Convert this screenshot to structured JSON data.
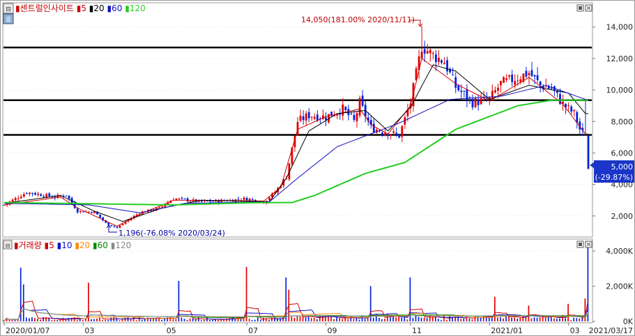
{
  "chart_data": [
    {
      "type": "candlestick",
      "title": "센트럴인사이트",
      "legend": [
        {
          "label": "5",
          "color": "#d00000"
        },
        {
          "label": "20",
          "color": "#000000"
        },
        {
          "label": "60",
          "color": "#1010c0"
        },
        {
          "label": "120",
          "color": "#22cc22"
        }
      ],
      "y_ticks": [
        "14,000",
        "12,000",
        "10,000",
        "8,000",
        "6,000",
        "4,000",
        "2,000"
      ],
      "y_tick_values": [
        14000,
        12000,
        10000,
        8000,
        6000,
        4000,
        2000
      ],
      "ylim": [
        750,
        15450
      ],
      "high_annotation": "14,050(181.00% 2020/11/11)",
      "low_annotation": "1,196(-76.08% 2020/03/24)",
      "current_price": "5,000",
      "current_change": "(-29.87%)",
      "horizontal_lines": [
        12700,
        9350,
        7150
      ],
      "price_anchors": [
        [
          0,
          2700
        ],
        [
          8,
          3500
        ],
        [
          18,
          3200
        ],
        [
          22,
          3350
        ],
        [
          26,
          2300
        ],
        [
          32,
          2250
        ],
        [
          36,
          1550
        ],
        [
          40,
          1250
        ],
        [
          44,
          1750
        ],
        [
          48,
          2200
        ],
        [
          55,
          2500
        ],
        [
          60,
          3100
        ],
        [
          70,
          2900
        ],
        [
          80,
          3000
        ],
        [
          86,
          3100
        ],
        [
          92,
          2900
        ],
        [
          96,
          3500
        ],
        [
          100,
          4500
        ],
        [
          104,
          8000
        ],
        [
          108,
          8400
        ],
        [
          114,
          8300
        ],
        [
          120,
          8800
        ],
        [
          124,
          8000
        ],
        [
          126,
          9200
        ],
        [
          130,
          7600
        ],
        [
          134,
          7400
        ],
        [
          140,
          7100
        ],
        [
          144,
          9200
        ],
        [
          148,
          12800
        ],
        [
          152,
          12200
        ],
        [
          156,
          11800
        ],
        [
          160,
          10200
        ],
        [
          166,
          9200
        ],
        [
          172,
          9400
        ],
        [
          176,
          10400
        ],
        [
          182,
          10800
        ],
        [
          186,
          11100
        ],
        [
          190,
          10300
        ],
        [
          194,
          10100
        ],
        [
          198,
          9100
        ],
        [
          202,
          8500
        ],
        [
          204,
          7500
        ],
        [
          206,
          7000
        ],
        [
          207,
          5000
        ]
      ],
      "ma_lines": {
        "ma5": [
          [
            0,
            2700
          ],
          [
            20,
            3200
          ],
          [
            26,
            2500
          ],
          [
            40,
            1350
          ],
          [
            48,
            2100
          ],
          [
            60,
            3000
          ],
          [
            92,
            2950
          ],
          [
            98,
            3800
          ],
          [
            104,
            7500
          ],
          [
            114,
            8300
          ],
          [
            126,
            8800
          ],
          [
            130,
            7800
          ],
          [
            136,
            7200
          ],
          [
            144,
            9000
          ],
          [
            148,
            12000
          ],
          [
            160,
            10400
          ],
          [
            172,
            9300
          ],
          [
            186,
            10800
          ],
          [
            198,
            9100
          ],
          [
            206,
            7200
          ]
        ],
        "ma20": [
          [
            0,
            2800
          ],
          [
            20,
            3300
          ],
          [
            32,
            2300
          ],
          [
            42,
            1650
          ],
          [
            56,
            2500
          ],
          [
            70,
            3000
          ],
          [
            94,
            2900
          ],
          [
            100,
            4400
          ],
          [
            108,
            7400
          ],
          [
            118,
            8500
          ],
          [
            128,
            8700
          ],
          [
            136,
            7400
          ],
          [
            144,
            8900
          ],
          [
            152,
            11600
          ],
          [
            160,
            11200
          ],
          [
            172,
            9400
          ],
          [
            186,
            10300
          ],
          [
            200,
            9800
          ],
          [
            206,
            8500
          ]
        ],
        "ma60": [
          [
            0,
            2800
          ],
          [
            30,
            2700
          ],
          [
            48,
            2200
          ],
          [
            64,
            2800
          ],
          [
            94,
            2900
          ],
          [
            104,
            4400
          ],
          [
            118,
            6400
          ],
          [
            140,
            7900
          ],
          [
            158,
            9400
          ],
          [
            176,
            9600
          ],
          [
            192,
            10300
          ],
          [
            206,
            9400
          ]
        ],
        "ma120": [
          [
            0,
            2850
          ],
          [
            40,
            2750
          ],
          [
            60,
            2700
          ],
          [
            90,
            2850
          ],
          [
            102,
            2850
          ],
          [
            110,
            3300
          ],
          [
            128,
            4700
          ],
          [
            142,
            5400
          ],
          [
            160,
            7500
          ],
          [
            182,
            9000
          ],
          [
            194,
            9350
          ],
          [
            206,
            9350
          ]
        ]
      }
    },
    {
      "type": "bar",
      "title": "거래량",
      "legend": [
        {
          "label": "5",
          "color": "#d00000"
        },
        {
          "label": "10",
          "color": "#1010c0"
        },
        {
          "label": "20",
          "color": "#ff8800"
        },
        {
          "label": "60",
          "color": "#008800"
        },
        {
          "label": "120",
          "color": "#888888"
        }
      ],
      "y_ticks": [
        "4,000K",
        "2,000K",
        "0K"
      ],
      "y_tick_values": [
        4000,
        2000,
        0
      ],
      "ylim": [
        0,
        4600
      ],
      "spikes": [
        [
          6,
          3050
        ],
        [
          7,
          2100
        ],
        [
          30,
          2200
        ],
        [
          62,
          2300
        ],
        [
          86,
          3100
        ],
        [
          100,
          2500
        ],
        [
          101,
          1800
        ],
        [
          130,
          2000
        ],
        [
          144,
          2500
        ],
        [
          174,
          1400
        ],
        [
          186,
          900
        ],
        [
          200,
          1000
        ],
        [
          207,
          4300
        ],
        [
          206,
          1300
        ]
      ]
    }
  ],
  "x_ticks": [
    "2020/01/07",
    "03",
    "05",
    "07",
    "09",
    "11",
    "2021/01",
    "03"
  ],
  "x_tick_positions": [
    0,
    28,
    57,
    86,
    114,
    144,
    172,
    200
  ],
  "x_end_label": "2021/03/17",
  "n_days": 208
}
